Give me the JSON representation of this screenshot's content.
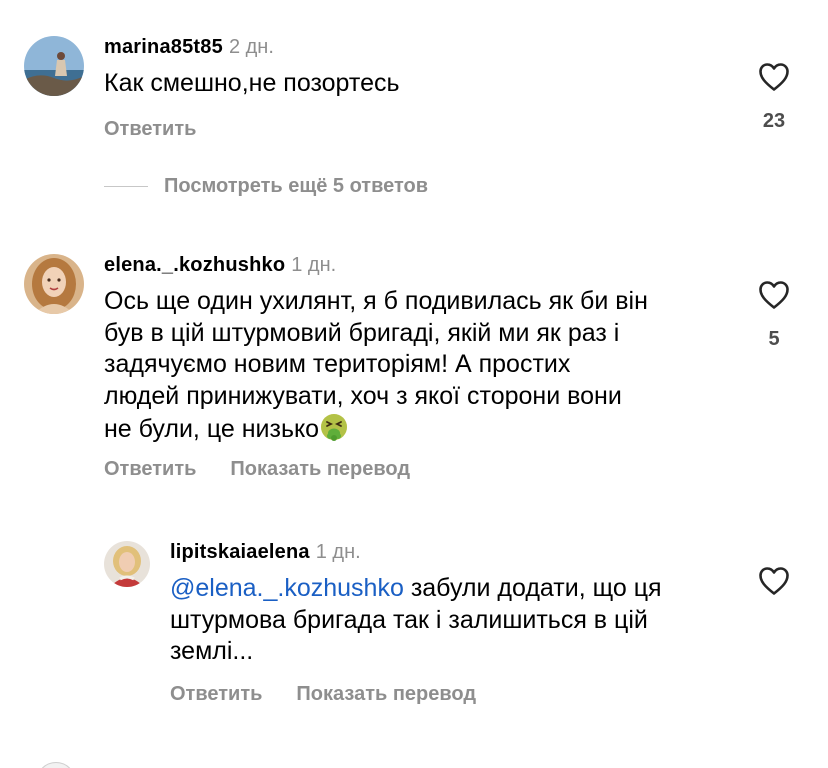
{
  "comments": [
    {
      "username": "marina85t85",
      "time": "2 дн.",
      "text": "Как смешно,не позортесь",
      "reply_label": "Ответить",
      "likes": "23"
    },
    {
      "username": "elena._.kozhushko",
      "time": "1 дн.",
      "text_lines": [
        "Ось ще один ухилянт, я б подивилась як би він",
        "був в цій штурмовий бригаді, якій ми як раз і",
        "задячуємо новим територіям! А простих",
        "людей принижувати, хоч з якої сторони вони",
        "не були, це низько"
      ],
      "emoji": "nauseated-face-icon",
      "reply_label": "Ответить",
      "translate_label": "Показать перевод",
      "likes": "5"
    },
    {
      "username": "lipitskaiaelena",
      "time": "1 дн.",
      "mention": "@elena._.kozhushko",
      "text_first": " забули додати, що ця",
      "text_lines": [
        "штурмова бригада так і залишиться в цій",
        "землі..."
      ],
      "reply_label": "Ответить",
      "translate_label": "Показать перевод"
    }
  ],
  "view_replies": "Посмотреть ещё 5 ответов",
  "colors": {
    "secondary_text": "#8e8e8e",
    "mention": "#1a5fc4",
    "heart_stroke": "#262626"
  }
}
